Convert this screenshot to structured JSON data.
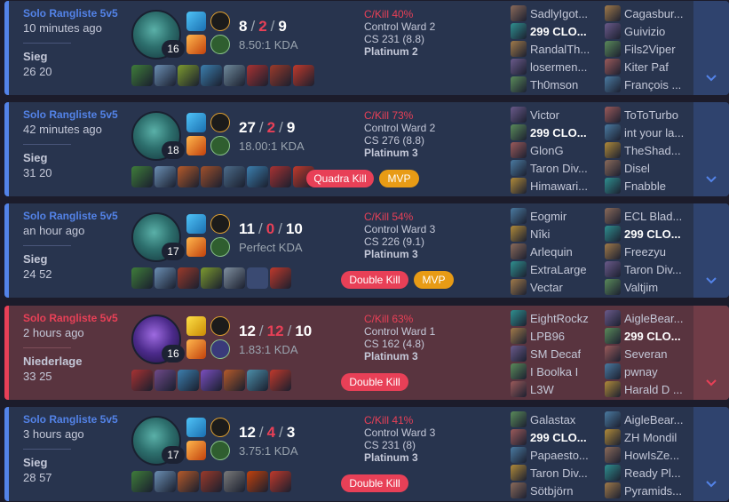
{
  "icons": {
    "expand": "chevron-down-icon",
    "champion": "champion-portrait",
    "spell": "summoner-spell-icon",
    "rune": "rune-icon",
    "item": "item-icon",
    "player": "player-champion-icon"
  },
  "colors": {
    "win_accent": "#5383e8",
    "loss_accent": "#e84057",
    "mvp": "#e89b15"
  },
  "matches": [
    {
      "outcome": "win",
      "queue": "Solo Rangliste 5v5",
      "time_ago": "10 minutes ago",
      "result": "Sieg",
      "duration": "26 20",
      "champion_level": "16",
      "kills": "8",
      "deaths": "2",
      "assists": "9",
      "kda_ratio": "8.50:1 KDA",
      "kill_participation": "C/Kill 40%",
      "control_wards": "Control Ward 2",
      "cs": "CS 231 (8.8)",
      "tier": "Platinum 2",
      "badges": [],
      "team_blue": [
        "SadlyIgot...",
        "299 CLO...",
        "RandalTh...",
        "losermen...",
        "Th0mson"
      ],
      "team_red": [
        "Cagasbur...",
        "Guivizio",
        "Fils2Viper",
        "Kiter Paf",
        "François ..."
      ],
      "me_team": "blue",
      "me_index": 1
    },
    {
      "outcome": "win",
      "queue": "Solo Rangliste 5v5",
      "time_ago": "42 minutes ago",
      "result": "Sieg",
      "duration": "31 20",
      "champion_level": "18",
      "kills": "27",
      "deaths": "2",
      "assists": "9",
      "kda_ratio": "18.00:1 KDA",
      "kill_participation": "C/Kill 73%",
      "control_wards": "Control Ward 2",
      "cs": "CS 276 (8.8)",
      "tier": "Platinum 3",
      "badges": [
        {
          "label": "Quadra Kill",
          "kind": "multi"
        },
        {
          "label": "MVP",
          "kind": "mvp"
        }
      ],
      "team_blue": [
        "Victor",
        "299 CLO...",
        "GlonG",
        "Taron Div...",
        "Himawari..."
      ],
      "team_red": [
        "ToToTurbo",
        "int your la...",
        "TheShad...",
        "Disel",
        "Fnabble"
      ],
      "me_team": "blue",
      "me_index": 1
    },
    {
      "outcome": "win",
      "queue": "Solo Rangliste 5v5",
      "time_ago": "an hour ago",
      "result": "Sieg",
      "duration": "24 52",
      "champion_level": "17",
      "kills": "11",
      "deaths": "0",
      "assists": "10",
      "kda_ratio": "Perfect KDA",
      "kill_participation": "C/Kill 54%",
      "control_wards": "Control Ward 3",
      "cs": "CS 226 (9.1)",
      "tier": "Platinum 3",
      "badges": [
        {
          "label": "Double Kill",
          "kind": "multi"
        },
        {
          "label": "MVP",
          "kind": "mvp"
        }
      ],
      "team_blue": [
        "Eogmir",
        "Nîki",
        "Arlequin",
        "ExtraLarge",
        "Vectar"
      ],
      "team_red": [
        "ECL Blad...",
        "299 CLO...",
        "Freezyu",
        "Taron Div...",
        "Valtjim"
      ],
      "me_team": "red",
      "me_index": 1
    },
    {
      "outcome": "loss",
      "queue": "Solo Rangliste 5v5",
      "time_ago": "2 hours ago",
      "result": "Niederlage",
      "duration": "33 25",
      "champion_level": "16",
      "kills": "12",
      "deaths": "12",
      "assists": "10",
      "kda_ratio": "1.83:1 KDA",
      "kill_participation": "C/Kill 63%",
      "control_wards": "Control Ward 1",
      "cs": "CS 162 (4.8)",
      "tier": "Platinum 3",
      "badges": [
        {
          "label": "Double Kill",
          "kind": "multi"
        }
      ],
      "team_blue": [
        "EightRockz",
        "LPB96",
        "SM Decaf",
        "I Boolka I",
        "L3W"
      ],
      "team_red": [
        "AigleBear...",
        "299 CLO...",
        "Severan",
        "pwnay",
        "Harald D ..."
      ],
      "me_team": "red",
      "me_index": 1
    },
    {
      "outcome": "win",
      "queue": "Solo Rangliste 5v5",
      "time_ago": "3 hours ago",
      "result": "Sieg",
      "duration": "28 57",
      "champion_level": "17",
      "kills": "12",
      "deaths": "4",
      "assists": "3",
      "kda_ratio": "3.75:1 KDA",
      "kill_participation": "C/Kill 41%",
      "control_wards": "Control Ward 3",
      "cs": "CS 231 (8)",
      "tier": "Platinum 3",
      "badges": [
        {
          "label": "Double Kill",
          "kind": "multi"
        }
      ],
      "team_blue": [
        "Galastax",
        "299 CLO...",
        "Papaesto...",
        "Taron Div...",
        "Sötbjörn"
      ],
      "team_red": [
        "AigleBear...",
        "ZH Mondil",
        "HowIsZe...",
        "Ready Pl...",
        "Pyramids..."
      ],
      "me_team": "blue",
      "me_index": 1
    }
  ]
}
